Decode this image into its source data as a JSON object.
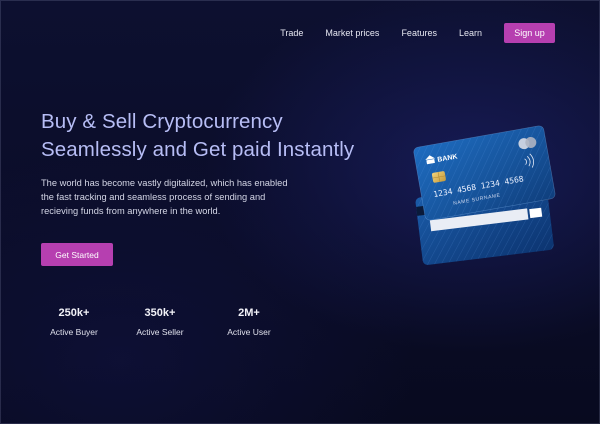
{
  "nav": {
    "links": [
      "Trade",
      "Market prices",
      "Features",
      "Learn"
    ],
    "signup_label": "Sign up"
  },
  "hero": {
    "title_lines": [
      "Buy & Sell Cryptocurrency",
      "Seamlessly and Get paid Instantly"
    ],
    "description_lines": [
      "The world has become vastly digitalized, which has enabled",
      "the fast tracking and seamless process of sending and",
      "recieving  funds from anywhere in the world."
    ],
    "cta_label": "Get Started"
  },
  "stats": [
    {
      "value": "250k+",
      "label": "Active Buyer"
    },
    {
      "value": "350k+",
      "label": "Active Seller"
    },
    {
      "value": "2M+",
      "label": "Active User"
    }
  ],
  "card": {
    "bank_label": "BANK",
    "number": "1234 4568 1234 4568",
    "holder": "NAME SURNAME"
  },
  "colors": {
    "accent": "#b63fb0",
    "title": "#b7bdf5",
    "background": "#0b0d2a",
    "card_blue": "#1d5fae"
  }
}
